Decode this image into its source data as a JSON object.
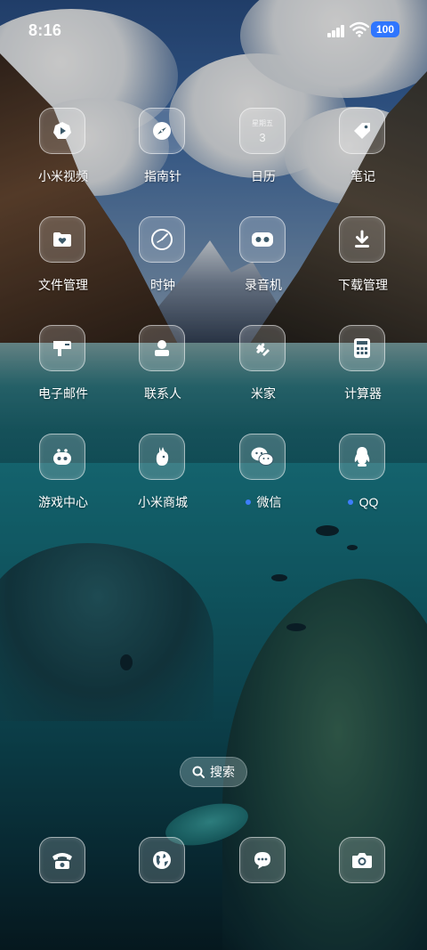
{
  "status_bar": {
    "time": "8:16",
    "battery": "100",
    "battery_color": "#2f76ff"
  },
  "apps": [
    {
      "label": "小米视频",
      "icon": "play-icon"
    },
    {
      "label": "指南针",
      "icon": "compass-icon"
    },
    {
      "label": "日历",
      "icon": "calendar-icon",
      "weekday": "星期五",
      "day": "3"
    },
    {
      "label": "笔记",
      "icon": "tag-icon"
    },
    {
      "label": "文件管理",
      "icon": "folder-icon"
    },
    {
      "label": "时钟",
      "icon": "clock-icon"
    },
    {
      "label": "录音机",
      "icon": "recorder-icon"
    },
    {
      "label": "下载管理",
      "icon": "download-icon"
    },
    {
      "label": "电子邮件",
      "icon": "mailbox-icon"
    },
    {
      "label": "联系人",
      "icon": "contact-icon"
    },
    {
      "label": "米家",
      "icon": "puzzle-icon"
    },
    {
      "label": "计算器",
      "icon": "calculator-icon"
    },
    {
      "label": "游戏中心",
      "icon": "gamepad-icon"
    },
    {
      "label": "小米商城",
      "icon": "bunny-icon"
    },
    {
      "label": "微信",
      "icon": "wechat-icon",
      "notification_dot": true
    },
    {
      "label": "QQ",
      "icon": "penguin-icon",
      "notification_dot": true
    }
  ],
  "search": {
    "label": "搜索",
    "icon": "search-icon"
  },
  "dock": [
    {
      "icon": "phone-icon"
    },
    {
      "icon": "browser-globe-icon"
    },
    {
      "icon": "message-icon"
    },
    {
      "icon": "camera-icon"
    }
  ],
  "colors": {
    "notification_dot": "#3e7dff",
    "icon_tile_border": "#ffffff"
  }
}
